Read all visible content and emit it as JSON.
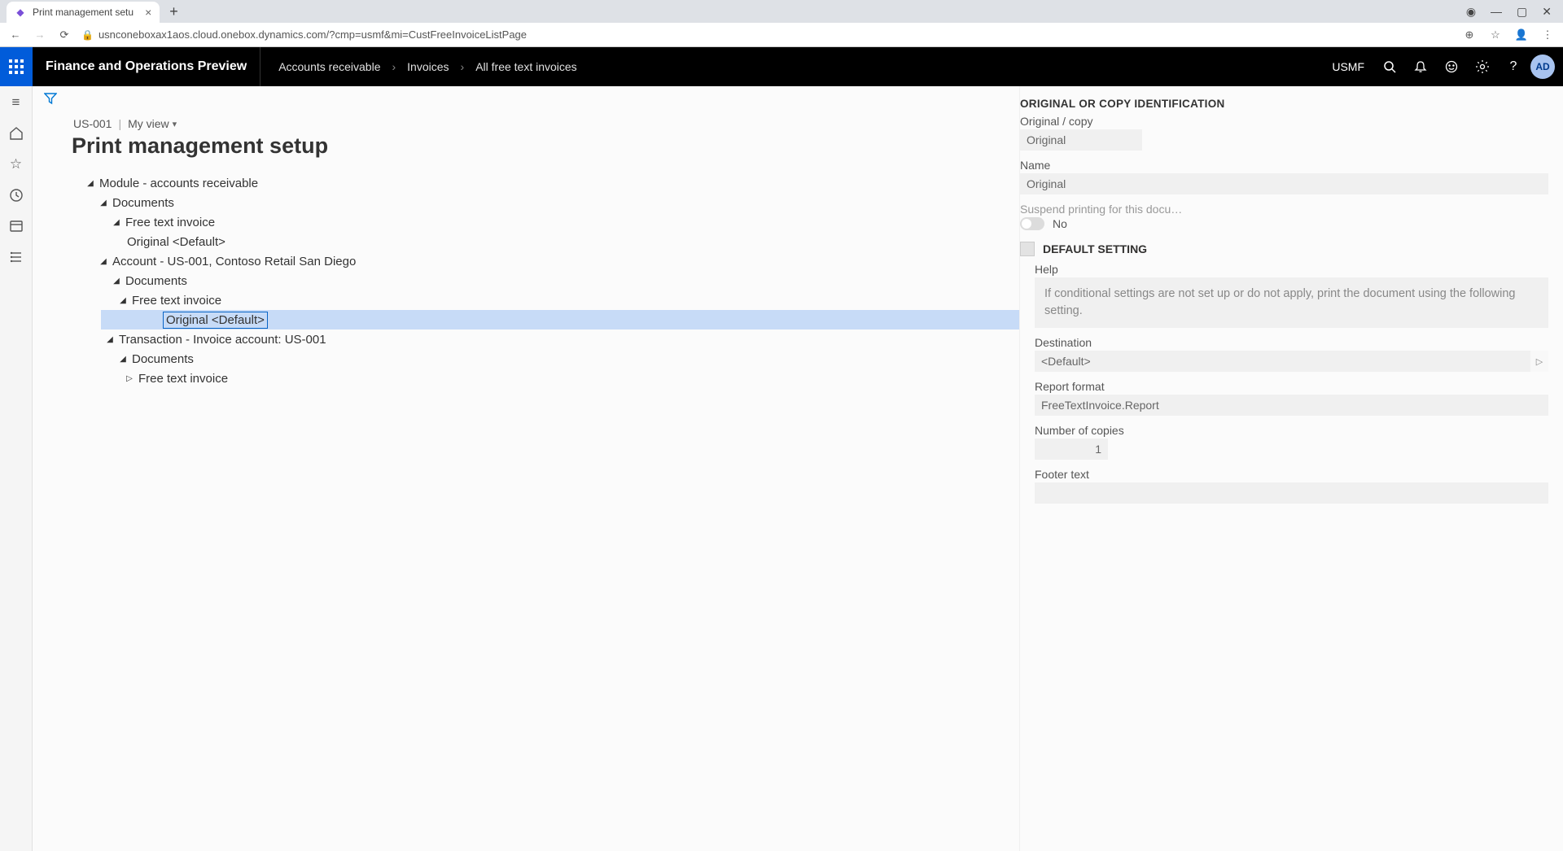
{
  "browser": {
    "tab_title": "Print management setu",
    "url": "usnconeboxax1aos.cloud.onebox.dynamics.com/?cmp=usmf&mi=CustFreeInvoiceListPage"
  },
  "app": {
    "title": "Finance and Operations Preview",
    "breadcrumb": [
      "Accounts receivable",
      "Invoices",
      "All free text invoices"
    ],
    "company": "USMF",
    "avatar": "AD"
  },
  "header": {
    "entity": "US-001",
    "view_label": "My view",
    "page_title": "Print management setup"
  },
  "tree": {
    "n0": "Module - accounts receivable",
    "n1": "Documents",
    "n2": "Free text invoice",
    "n3": "Original <Default>",
    "n4": "Account - US-001, Contoso Retail San Diego",
    "n5": "Documents",
    "n6": "Free text invoice",
    "n7": "Original <Default>",
    "n8": "Transaction - Invoice account: US-001",
    "n9": "Documents",
    "n10": "Free text invoice"
  },
  "details": {
    "section1_title": "ORIGINAL OR COPY IDENTIFICATION",
    "orig_copy_label": "Original / copy",
    "orig_copy_value": "Original",
    "name_label": "Name",
    "name_value": "Original",
    "suspend_label": "Suspend printing for this docu…",
    "suspend_value": "No",
    "default_setting_label": "DEFAULT SETTING",
    "help_label": "Help",
    "help_text": "If conditional settings are not set up or do not apply, print the document using the following setting.",
    "destination_label": "Destination",
    "destination_value": "<Default>",
    "report_format_label": "Report format",
    "report_format_value": "FreeTextInvoice.Report",
    "copies_label": "Number of copies",
    "copies_value": "1",
    "footer_label": "Footer text",
    "footer_value": ""
  }
}
